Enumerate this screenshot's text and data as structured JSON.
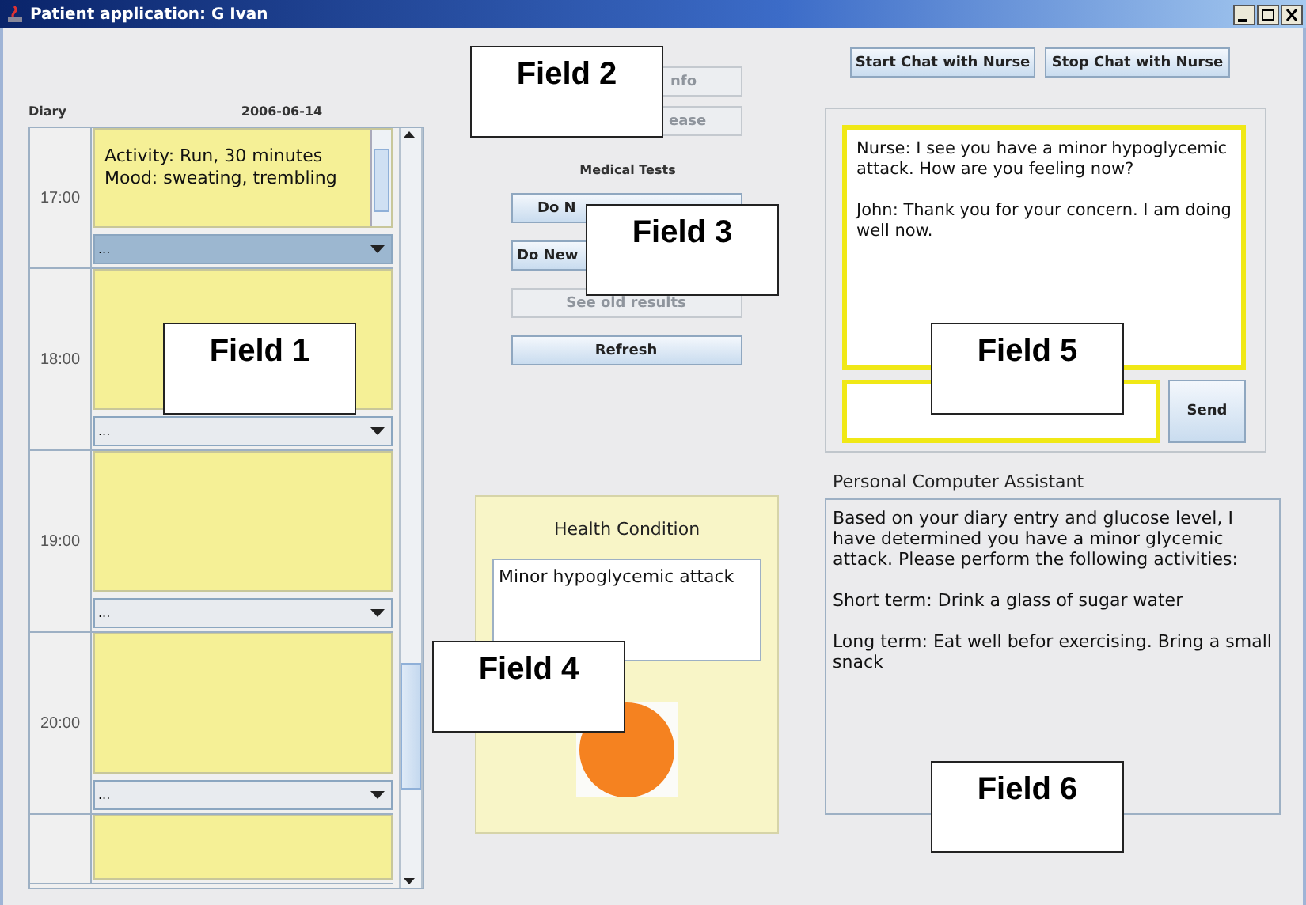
{
  "window": {
    "title": "Patient application: G Ivan"
  },
  "diary": {
    "label": "Diary",
    "date": "2006-06-14",
    "rows": [
      {
        "time": "17:00",
        "entry": "Activity: Run, 30 minutes\nMood: sweating, trembling",
        "dropdown": {
          "value": "...",
          "selected": true
        }
      },
      {
        "time": "18:00",
        "dropdown": {
          "value": "...",
          "selected": false
        }
      },
      {
        "time": "19:00",
        "dropdown": {
          "value": "...",
          "selected": false
        }
      },
      {
        "time": "20:00",
        "dropdown": {
          "value": "...",
          "selected": false
        }
      },
      {}
    ]
  },
  "info_buttons": [
    {
      "label": "nfo",
      "disabled": true
    },
    {
      "label": "ease",
      "disabled": true
    }
  ],
  "medical_tests": {
    "title": "Medical Tests",
    "buttons": [
      {
        "label": "Do N",
        "disabled": false
      },
      {
        "label": "Do New",
        "disabled": false
      },
      {
        "label": "See old results",
        "disabled": true
      },
      {
        "label": "Refresh",
        "disabled": false
      }
    ]
  },
  "health": {
    "title": "Health Condition",
    "condition": "Minor hypoglycemic attack"
  },
  "chat": {
    "buttons": [
      {
        "label": "Start Chat with Nurse"
      },
      {
        "label": "Stop Chat with Nurse"
      }
    ],
    "messages": [
      "Nurse: I see you have a minor hypoglycemic attack. How are you feeling now?",
      "John: Thank you for your concern. I am doing well now."
    ],
    "send_label": "Send"
  },
  "assistant": {
    "title": "Personal Computer Assistant",
    "paragraphs": [
      "Based on your diary entry and glucose level, I have determined you have a minor glycemic attack. Please perform the following activities:",
      "Short term: Drink a glass of sugar water",
      "Long term: Eat well befor exercising. Bring a small snack"
    ]
  },
  "callouts": [
    {
      "label": "Field 1"
    },
    {
      "label": "Field 2"
    },
    {
      "label": "Field 3"
    },
    {
      "label": "Field 4"
    },
    {
      "label": "Field 5"
    },
    {
      "label": "Field 6"
    }
  ]
}
